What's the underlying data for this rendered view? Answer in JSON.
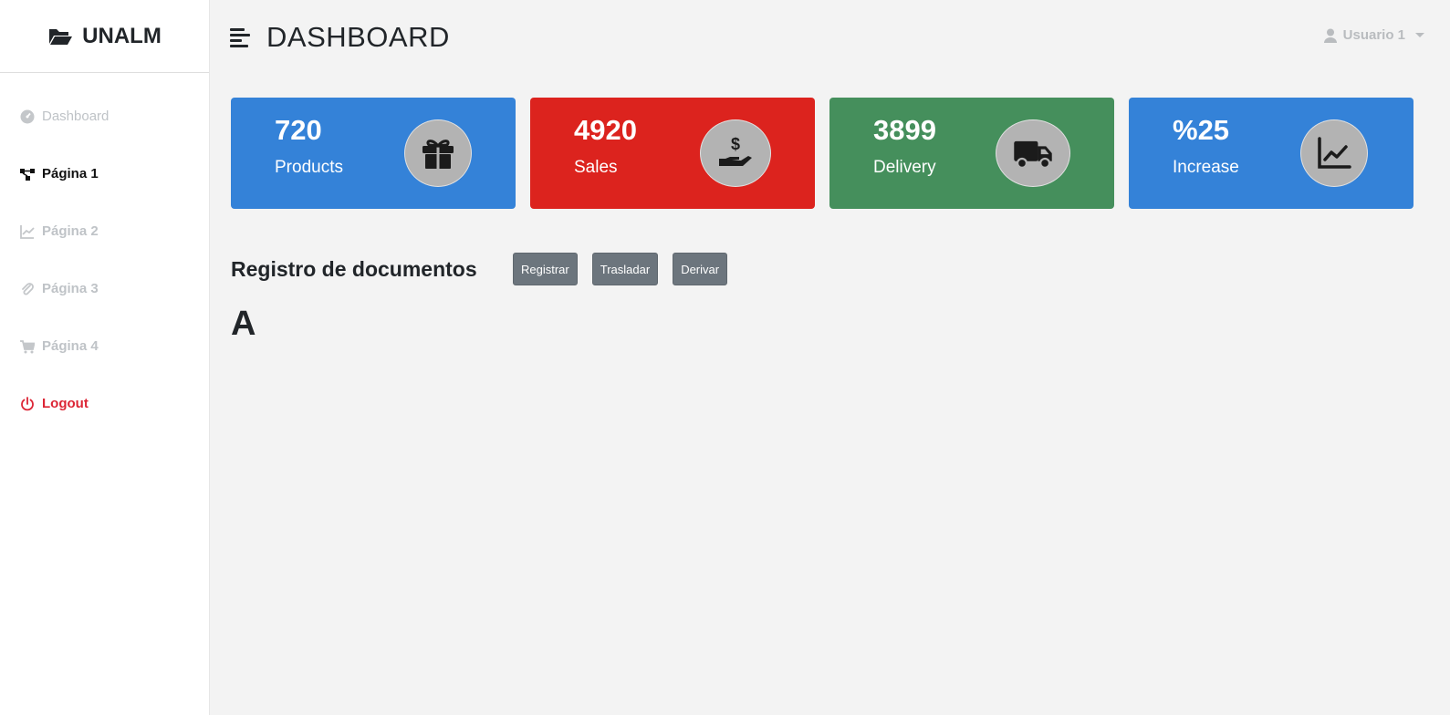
{
  "brand": {
    "name": "UNALM",
    "icon": "folder-open-icon"
  },
  "sidebar": {
    "items": [
      {
        "label": "Dashboard",
        "icon": "dashboard-gauge-icon",
        "state": "muted"
      },
      {
        "label": "Página 1",
        "icon": "diagram-nodes-icon",
        "state": "active"
      },
      {
        "label": "Página 2",
        "icon": "line-chart-icon",
        "state": "muted"
      },
      {
        "label": "Página 3",
        "icon": "paperclip-icon",
        "state": "muted"
      },
      {
        "label": "Página 4",
        "icon": "cart-icon",
        "state": "muted"
      },
      {
        "label": "Logout",
        "icon": "power-icon",
        "state": "logout"
      }
    ]
  },
  "header": {
    "title": "DASHBOARD",
    "menu_icon": "hamburger-icon"
  },
  "user": {
    "name": "Usuario 1",
    "icon": "user-icon"
  },
  "cards": [
    {
      "value": "720",
      "label": "Products",
      "color": "#3482d8",
      "icon": "gift-icon"
    },
    {
      "value": "4920",
      "label": "Sales",
      "color": "#dc231e",
      "icon": "hand-dollar-icon"
    },
    {
      "value": "3899",
      "label": "Delivery",
      "color": "#458f5c",
      "icon": "truck-icon"
    },
    {
      "value": "%25",
      "label": "Increase",
      "color": "#3482d8",
      "icon": "trend-chart-icon"
    }
  ],
  "section": {
    "title": "Registro de documentos",
    "buttons": [
      "Registrar",
      "Trasladar",
      "Derivar"
    ],
    "big_letter": "A"
  },
  "colors": {
    "sidebar_bg": "#ffffff",
    "page_bg": "#f3f3f3",
    "button_bg": "#6c757d",
    "logout": "#dc2535"
  }
}
